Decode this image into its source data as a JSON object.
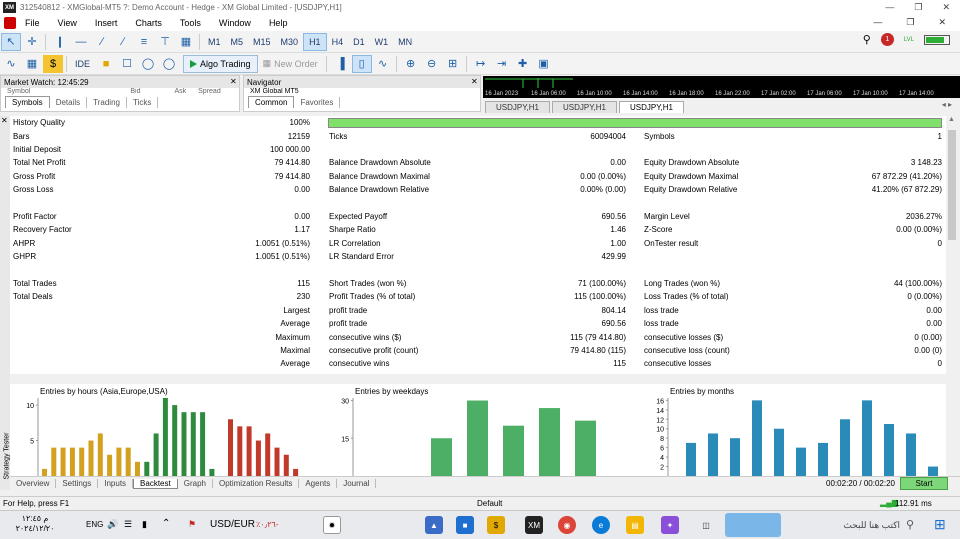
{
  "window": {
    "title": "312540812 - XMGlobal-MT5 ?: Demo Account - Hedge - XM Global Limited - [USDJPY,H1]"
  },
  "menu": [
    "File",
    "View",
    "Insert",
    "Charts",
    "Tools",
    "Window",
    "Help"
  ],
  "toolbar": {
    "timeframes": [
      "M1",
      "M5",
      "M15",
      "M30",
      "H1",
      "H4",
      "D1",
      "W1",
      "MN"
    ],
    "selected_timeframe": "H1",
    "ide_label": "IDE",
    "algo_trading_label": "Algo Trading",
    "new_order_label": "New Order",
    "notification_count": "1",
    "signal_label": "LVL"
  },
  "market_watch": {
    "header": "Market Watch: 12:45:29",
    "col_symbol": "Symbol",
    "col_bid": "Bid",
    "col_ask": "Ask",
    "col_spread": "Spread",
    "tabs": [
      "Symbols",
      "Details",
      "Trading",
      "Ticks"
    ]
  },
  "navigator": {
    "header": "Navigator",
    "root": "XM Global MT5",
    "tabs": [
      "Common",
      "Favorites"
    ]
  },
  "chart_axis": [
    "16 Jan 2023",
    "16 Jan 06:00",
    "16 Jan 10:00",
    "16 Jan 14:00",
    "16 Jan 18:00",
    "16 Jan 22:00",
    "17 Jan 02:00",
    "17 Jan 06:00",
    "17 Jan 10:00",
    "17 Jan 14:00"
  ],
  "chart_tabs": [
    "USDJPY,H1",
    "USDJPY,H1",
    "USDJPY,H1"
  ],
  "stats": {
    "history_quality_label": "History Quality",
    "history_quality_value": "100%",
    "rows": [
      {
        "a": "Bars",
        "av": "12159",
        "b": "Ticks",
        "bv": "60094004",
        "c": "Symbols",
        "cv": "1"
      },
      {
        "a": "Initial Deposit",
        "av": "100 000.00",
        "b": "",
        "bv": "",
        "c": "",
        "cv": ""
      },
      {
        "a": "Total Net Profit",
        "av": "79 414.80",
        "b": "Balance Drawdown Absolute",
        "bv": "0.00",
        "c": "Equity Drawdown Absolute",
        "cv": "3 148.23"
      },
      {
        "a": "Gross Profit",
        "av": "79 414.80",
        "b": "Balance Drawdown Maximal",
        "bv": "0.00 (0.00%)",
        "c": "Equity Drawdown Maximal",
        "cv": "67 872.29 (41.20%)"
      },
      {
        "a": "Gross Loss",
        "av": "0.00",
        "b": "Balance Drawdown Relative",
        "bv": "0.00% (0.00)",
        "c": "Equity Drawdown Relative",
        "cv": "41.20% (67 872.29)"
      },
      {
        "a": "",
        "av": "",
        "b": "",
        "bv": "",
        "c": "",
        "cv": ""
      },
      {
        "a": "Profit Factor",
        "av": "0.00",
        "b": "Expected Payoff",
        "bv": "690.56",
        "c": "Margin Level",
        "cv": "2036.27%"
      },
      {
        "a": "Recovery Factor",
        "av": "1.17",
        "b": "Sharpe Ratio",
        "bv": "1.46",
        "c": "Z-Score",
        "cv": "0.00 (0.00%)"
      },
      {
        "a": "AHPR",
        "av": "1.0051 (0.51%)",
        "b": "LR Correlation",
        "bv": "1.00",
        "c": "OnTester result",
        "cv": "0"
      },
      {
        "a": "GHPR",
        "av": "1.0051 (0.51%)",
        "b": "LR Standard Error",
        "bv": "429.99",
        "c": "",
        "cv": ""
      },
      {
        "a": "",
        "av": "",
        "b": "",
        "bv": "",
        "c": "",
        "cv": ""
      },
      {
        "a": "Total Trades",
        "av": "115",
        "b": "Short Trades (won %)",
        "bv": "71 (100.00%)",
        "c": "Long Trades (won %)",
        "cv": "44 (100.00%)"
      },
      {
        "a": "Total Deals",
        "av": "230",
        "b": "Profit Trades (% of total)",
        "bv": "115 (100.00%)",
        "c": "Loss Trades (% of total)",
        "cv": "0 (0.00%)"
      },
      {
        "a": "",
        "av": "Largest",
        "b": "profit trade",
        "bv": "804.14",
        "c": "loss trade",
        "cv": "0.00"
      },
      {
        "a": "",
        "av": "Average",
        "b": "profit trade",
        "bv": "690.56",
        "c": "loss trade",
        "cv": "0.00"
      },
      {
        "a": "",
        "av": "Maximum",
        "b": "consecutive wins ($)",
        "bv": "115 (79 414.80)",
        "c": "consecutive losses ($)",
        "cv": "0 (0.00)"
      },
      {
        "a": "",
        "av": "Maximal",
        "b": "consecutive profit (count)",
        "bv": "79 414.80 (115)",
        "c": "consecutive loss (count)",
        "cv": "0.00 (0)"
      },
      {
        "a": "",
        "av": "Average",
        "b": "consecutive wins",
        "bv": "115",
        "c": "consecutive losses",
        "cv": "0"
      }
    ]
  },
  "chart_data": [
    {
      "type": "bar",
      "title": "Entries by hours (Asia,Europe,USA)",
      "ylim": [
        0,
        11
      ],
      "yticks": [
        "10",
        "5"
      ],
      "values": [
        1,
        4,
        4,
        4,
        4,
        5,
        6,
        3,
        4,
        4,
        2,
        2,
        6,
        11,
        10,
        9,
        9,
        9,
        1,
        0,
        8,
        7,
        7,
        5,
        6,
        4,
        3,
        1
      ],
      "colors": [
        "#d4a020",
        "#d4a020",
        "#d4a020",
        "#d4a020",
        "#d4a020",
        "#d4a020",
        "#d4a020",
        "#d4a020",
        "#d4a020",
        "#d4a020",
        "#d4a020",
        "#2e8b3e",
        "#2e8b3e",
        "#2e8b3e",
        "#2e8b3e",
        "#2e8b3e",
        "#2e8b3e",
        "#2e8b3e",
        "#2e8b3e",
        "#2e8b3e",
        "#c0392b",
        "#c0392b",
        "#c0392b",
        "#c0392b",
        "#c0392b",
        "#c0392b",
        "#c0392b",
        "#c0392b"
      ]
    },
    {
      "type": "bar",
      "title": "Entries by weekdays",
      "ylim": [
        0,
        31
      ],
      "yticks": [
        "30",
        "15"
      ],
      "values": [
        0,
        15,
        30,
        20,
        27,
        22,
        0
      ],
      "color": "#4caf65"
    },
    {
      "type": "bar",
      "title": "Entries by months",
      "ylim": [
        0,
        16.5
      ],
      "yticks": [
        "16",
        "14",
        "12",
        "10",
        "8",
        "6",
        "4",
        "2"
      ],
      "values": [
        7,
        9,
        8,
        16,
        10,
        6,
        7,
        12,
        16,
        11,
        9,
        2
      ],
      "color": "#2a8ab8"
    }
  ],
  "tester_tabs": [
    "Overview",
    "Settings",
    "Inputs",
    "Backtest",
    "Graph",
    "Optimization Results",
    "Agents",
    "Journal"
  ],
  "tester": {
    "side_label": "Strategy Tester",
    "timer": "00:02:20 / 00:02:20",
    "start_label": "Start"
  },
  "status": {
    "help": "For Help, press F1",
    "profile": "Default",
    "ping": "112.91 ms"
  },
  "taskbar": {
    "search_placeholder": "اكتب هنا للبحث",
    "ticker": "USD/EUR",
    "ticker_change": "٪٠٫٢٦-",
    "lang": "ENG",
    "time": "م ١٢:٤٥",
    "date": "٢٠٢٤/١٢/٢٠"
  }
}
